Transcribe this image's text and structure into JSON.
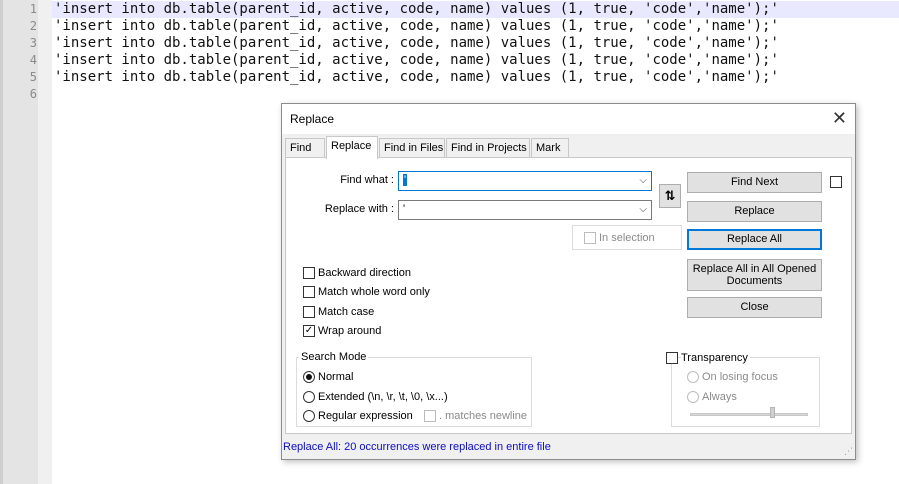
{
  "editor": {
    "line_numbers": [
      "1",
      "2",
      "3",
      "4",
      "5",
      "6"
    ],
    "lines": [
      "'insert into db.table(parent_id, active, code, name) values (1, true, 'code','name');'",
      "'insert into db.table(parent_id, active, code, name) values (1, true, 'code','name');'",
      "'insert into db.table(parent_id, active, code, name) values (1, true, 'code','name');'",
      "'insert into db.table(parent_id, active, code, name) values (1, true, 'code','name');'",
      "'insert into db.table(parent_id, active, code, name) values (1, true, 'code','name');'",
      ""
    ]
  },
  "dialog": {
    "title": "Replace",
    "close_glyph": "✕",
    "tabs": [
      "Find",
      "Replace",
      "Find in Files",
      "Find in Projects",
      "Mark"
    ],
    "find_what_label": "Find what :",
    "find_what_value": "'",
    "replace_with_label": "Replace with :",
    "replace_with_value": "'",
    "dropdown_glyph": "⌵",
    "swap_glyph": "⇅",
    "buttons": {
      "find_next": "Find Next",
      "replace": "Replace",
      "replace_all": "Replace All",
      "replace_all_opened": "Replace All in All Opened Documents",
      "close": "Close"
    },
    "in_selection": "In selection",
    "options": {
      "backward": "Backward direction",
      "whole_word": "Match whole word only",
      "match_case": "Match case",
      "wrap_around": "Wrap around",
      "check_glyph": "✓"
    },
    "search_mode": {
      "title": "Search Mode",
      "normal": "Normal",
      "extended": "Extended (\\n, \\r, \\t, \\0, \\x...)",
      "regex": "Regular expression",
      "matches_newline": ". matches newline"
    },
    "transparency": {
      "title": "Transparency",
      "on_losing_focus": "On losing focus",
      "always": "Always"
    },
    "status": "Replace All: 20 occurrences were replaced in entire file",
    "grip_glyph": "⋰"
  },
  "colors": {
    "current_line": "#e8e8ff",
    "status_text": "#0c0cc8",
    "focus_border": "#0078d7"
  }
}
